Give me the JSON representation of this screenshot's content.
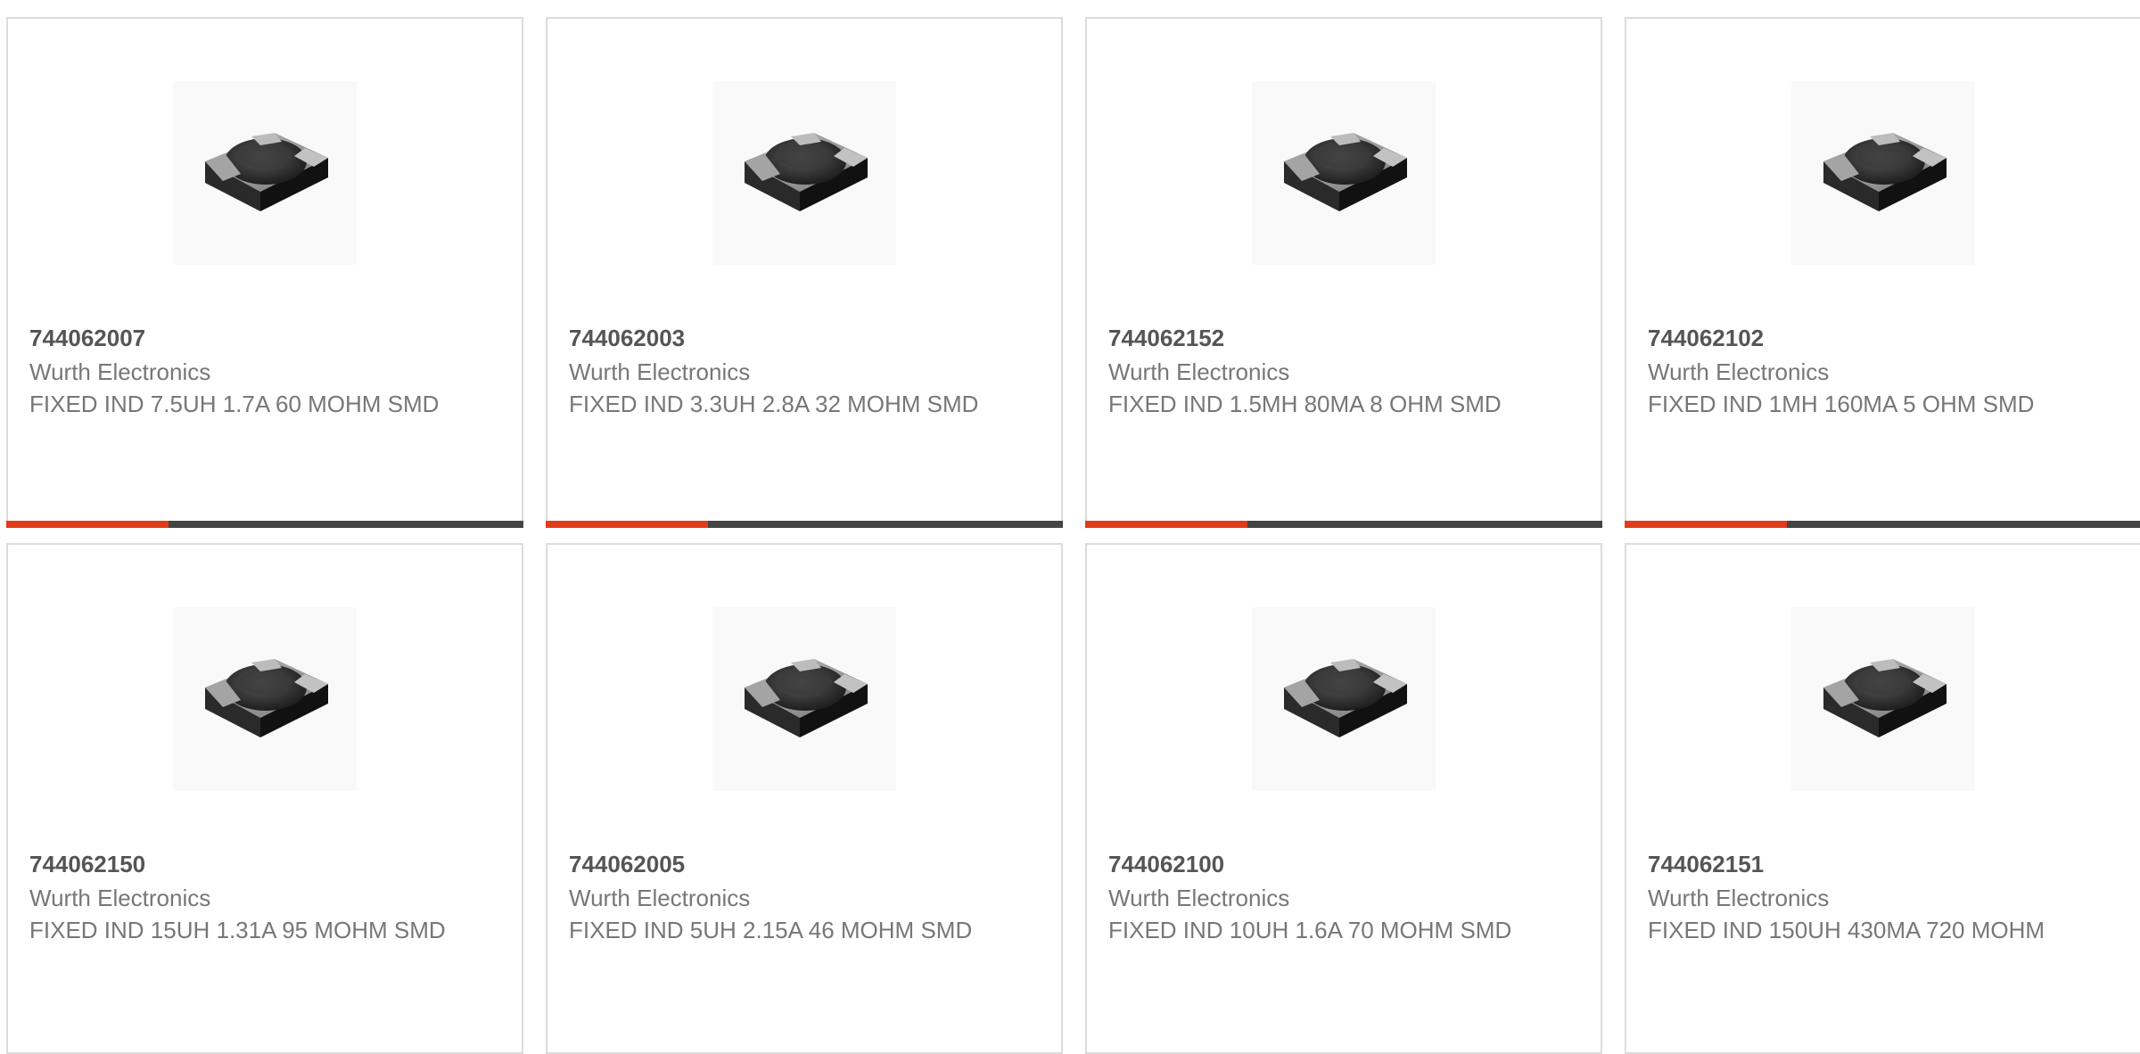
{
  "accent_color": "#e03c1a",
  "bar_color": "#444444",
  "image_icon": "smd-power-inductor",
  "products": [
    {
      "part_number": "744062007",
      "manufacturer": "Wurth Electronics",
      "description": "FIXED IND 7.5UH 1.7A 60 MOHM SMD",
      "has_bar": true
    },
    {
      "part_number": "744062003",
      "manufacturer": "Wurth Electronics",
      "description": "FIXED IND 3.3UH 2.8A 32 MOHM SMD",
      "has_bar": true
    },
    {
      "part_number": "744062152",
      "manufacturer": "Wurth Electronics",
      "description": "FIXED IND 1.5MH 80MA 8 OHM SMD",
      "has_bar": true
    },
    {
      "part_number": "744062102",
      "manufacturer": "Wurth Electronics",
      "description": "FIXED IND 1MH 160MA 5 OHM SMD",
      "has_bar": true
    },
    {
      "part_number": "744062150",
      "manufacturer": "Wurth Electronics",
      "description": "FIXED IND 15UH 1.31A 95 MOHM SMD",
      "has_bar": false
    },
    {
      "part_number": "744062005",
      "manufacturer": "Wurth Electronics",
      "description": "FIXED IND 5UH 2.15A 46 MOHM SMD",
      "has_bar": false
    },
    {
      "part_number": "744062100",
      "manufacturer": "Wurth Electronics",
      "description": "FIXED IND 10UH 1.6A 70 MOHM SMD",
      "has_bar": false
    },
    {
      "part_number": "744062151",
      "manufacturer": "Wurth Electronics",
      "description": "FIXED IND 150UH 430MA 720 MOHM",
      "has_bar": false
    }
  ]
}
